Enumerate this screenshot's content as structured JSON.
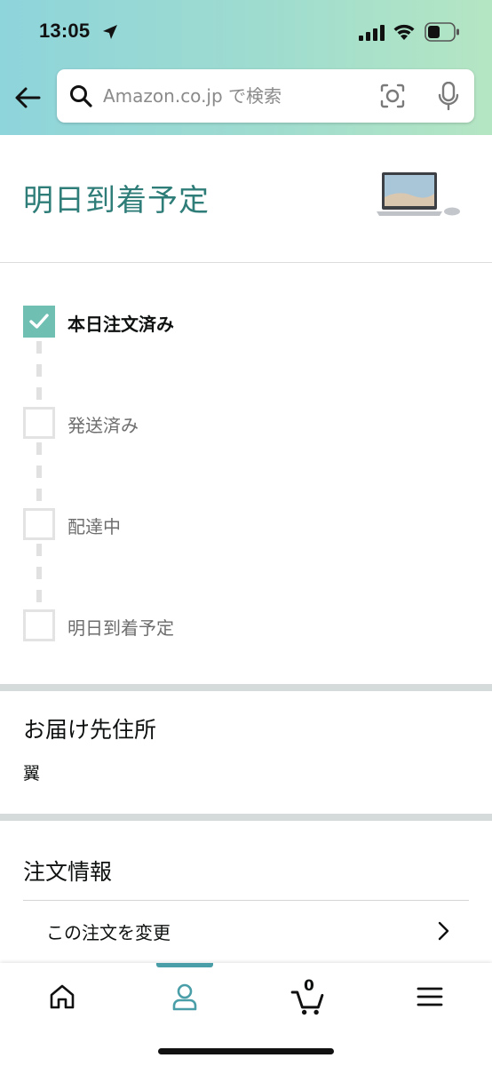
{
  "status_bar": {
    "time": "13:05"
  },
  "search": {
    "placeholder": "Amazon.co.jp で検索"
  },
  "delivery": {
    "title": "明日到着予定",
    "steps": [
      {
        "label": "本日注文済み",
        "done": true
      },
      {
        "label": "発送済み",
        "done": false
      },
      {
        "label": "配達中",
        "done": false
      },
      {
        "label": "明日到着予定",
        "done": false
      }
    ]
  },
  "address": {
    "title": "お届け先住所",
    "name": "翼"
  },
  "order_info": {
    "title": "注文情報",
    "change_order_label": "この注文を変更"
  },
  "bottom_nav": {
    "cart_count": "0",
    "active_tab": "account"
  },
  "colors": {
    "accent": "#2f7d78",
    "check": "#6fbfb3",
    "nav_active": "#4a9ea8"
  },
  "icons": [
    "location-arrow-icon",
    "signal-icon",
    "wifi-icon",
    "battery-icon",
    "back-arrow-icon",
    "search-icon",
    "camera-icon",
    "mic-icon",
    "laptop-image",
    "checkmark-icon",
    "chevron-right-icon",
    "home-icon",
    "account-icon",
    "cart-icon",
    "menu-icon"
  ]
}
